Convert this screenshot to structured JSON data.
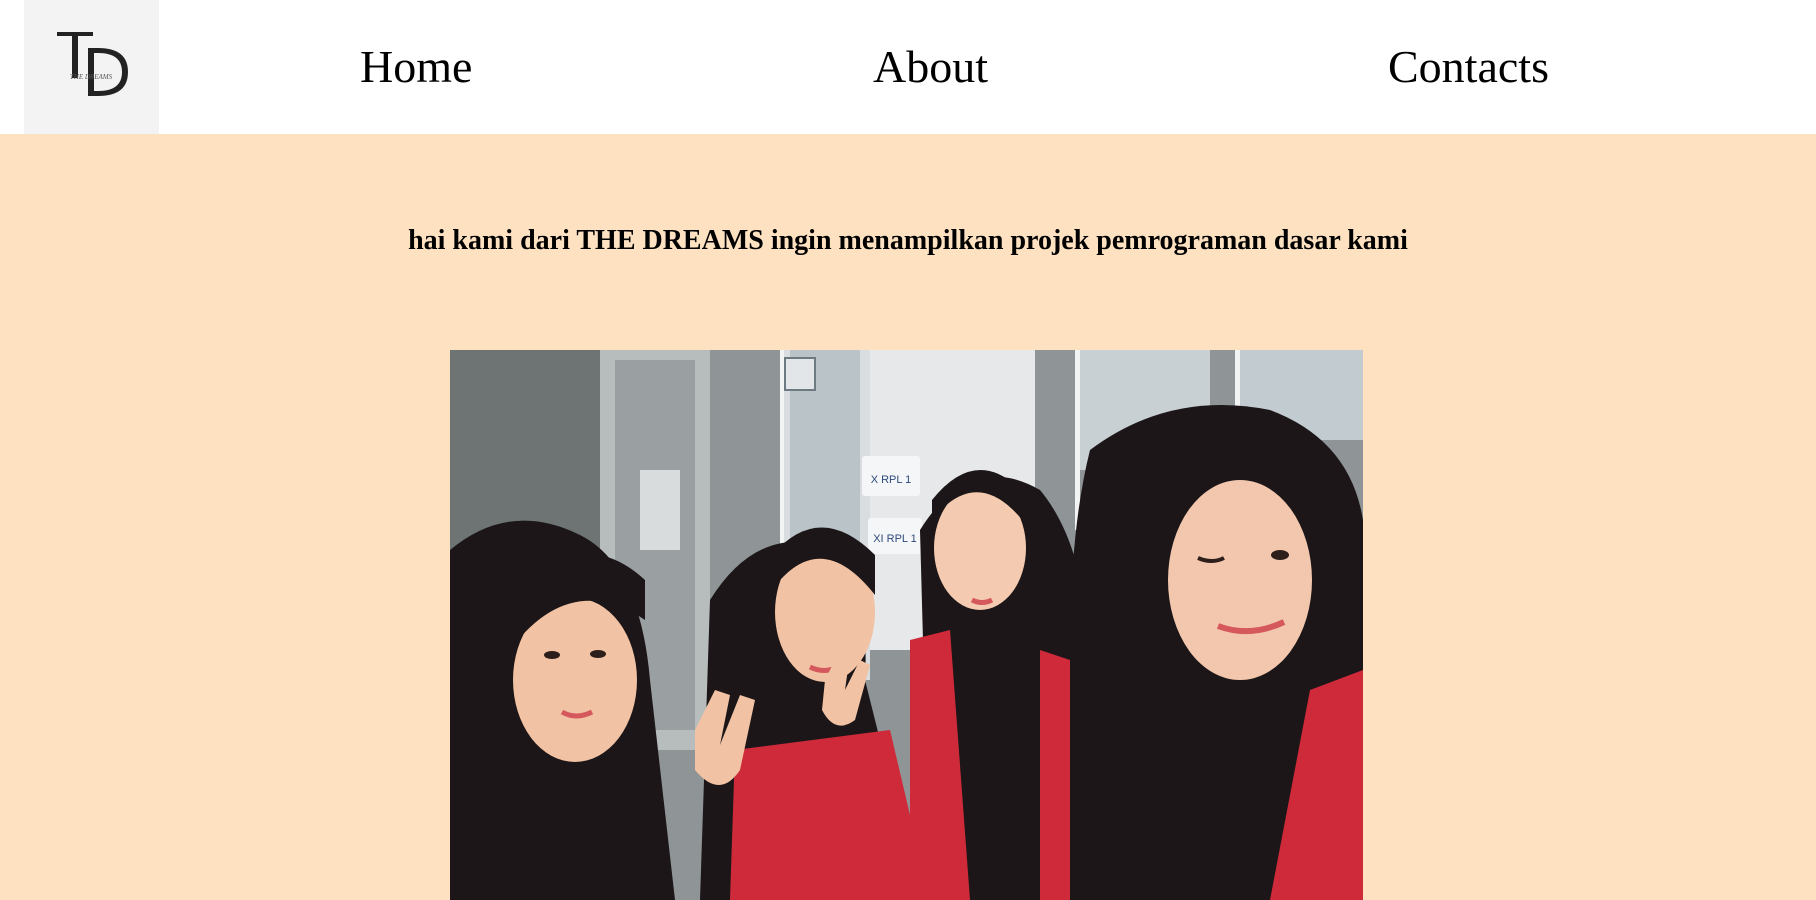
{
  "header": {
    "logo": {
      "letters": "TD",
      "tagline": "THE DREAMS"
    },
    "nav": [
      {
        "label": "Home"
      },
      {
        "label": "About"
      },
      {
        "label": "Contacts"
      }
    ]
  },
  "main": {
    "intro_text": "hai kami dari THE DREAMS ingin menampilkan projek pemrograman dasar kami",
    "photo": {
      "subject": "group selfie of four girls in black hijabs and red batik uniforms",
      "sign_labels": [
        "X RPL 1",
        "XI RPL 1"
      ]
    }
  },
  "colors": {
    "page_background": "#fde1c1",
    "header_background": "#ffffff",
    "logo_background": "#f3f3f3",
    "text": "#000000",
    "hijab": "#1c1618",
    "batik_red": "#cf2a3a"
  }
}
